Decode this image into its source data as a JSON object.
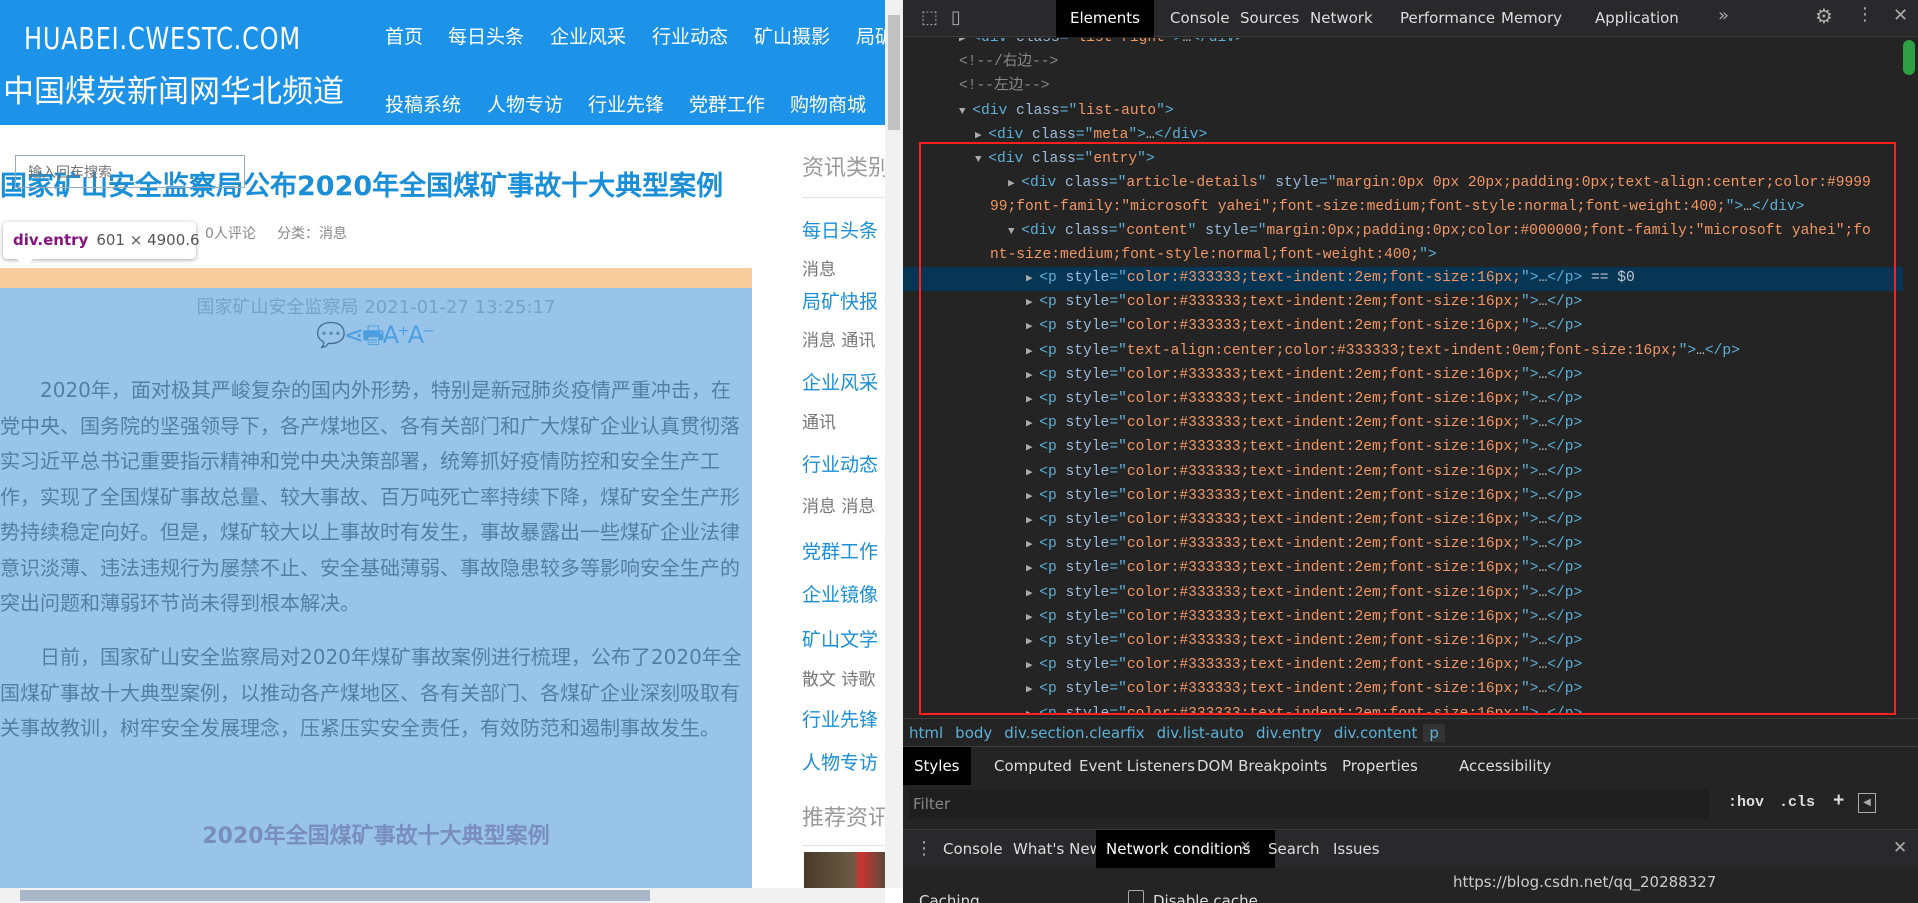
{
  "page": {
    "logo_en": "HUABEI.CWESTC.COM",
    "logo_cn": "中国煤炭新闻网华北频道",
    "nav_row1": [
      "首页",
      "每日头条",
      "企业风采",
      "行业动态",
      "矿山摄影",
      "局矿快报"
    ],
    "nav_row2": [
      "投稿系统",
      "人物专访",
      "行业先锋",
      "党群工作",
      "购物商城"
    ],
    "search_placeholder": "输入回车搜索",
    "title": "国家矿山安全监察局公布2020年全国煤矿事故十大典型案例",
    "meta_comments": "0人评论",
    "meta_category": "分类：消息",
    "tooltip": {
      "name": "div.entry",
      "size": "601 × 4900.6"
    },
    "article_source": "国家矿山安全监察局 2021-01-27 13:25:17",
    "share_icons": "💬⋖🖶A⁺A⁻",
    "paragraphs": [
      "2020年，面对极其严峻复杂的国内外形势，特别是新冠肺炎疫情严重冲击，在党中央、国务院的坚强领导下，各产煤地区、各有关部门和广大煤矿企业认真贯彻落实习近平总书记重要指示精神和党中央决策部署，统筹抓好疫情防控和安全生产工作，实现了全国煤矿事故总量、较大事故、百万吨死亡率持续下降，煤矿安全生产形势持续稳定向好。但是，煤矿较大以上事故时有发生，事故暴露出一些煤矿企业法律意识淡薄、违法违规行为屡禁不止、安全基础薄弱、事故隐患较多等影响安全生产的突出问题和薄弱环节尚未得到根本解决。",
      "日前，国家矿山安全监察局对2020年煤矿事故案例进行梳理，公布了2020年全国煤矿事故十大典型案例，以推动各产煤地区、各有关部门、各煤矿企业深刻吸取有关事故教训，树牢安全发展理念，压紧压实安全责任，有效防范和遏制事故发生。"
    ],
    "subheading": "2020年全国煤矿事故十大典型案例",
    "sidebar": {
      "heading": "资讯类别",
      "items": [
        {
          "label": "每日头条",
          "tags": "消息"
        },
        {
          "label": "局矿快报",
          "tags": "消息  通讯"
        },
        {
          "label": "企业风采",
          "tags": "通讯"
        },
        {
          "label": "行业动态",
          "tags": "消息  消息"
        },
        {
          "label": "党群工作",
          "tags": ""
        },
        {
          "label": "企业镜像",
          "tags": ""
        },
        {
          "label": "矿山文学",
          "tags": "散文  诗歌"
        },
        {
          "label": "行业先锋",
          "tags": ""
        },
        {
          "label": "人物专访",
          "tags": ""
        }
      ],
      "heading2": "推荐资讯"
    }
  },
  "devtools": {
    "tabs": [
      "Elements",
      "Console",
      "Sources",
      "Network",
      "Performance",
      "Memory",
      "Application"
    ],
    "active_tab": "Elements",
    "more": "»",
    "dom_lines": [
      {
        "i": 1,
        "ar": "▶",
        "s": [
          [
            "t",
            "<div "
          ],
          [
            "a",
            "class"
          ],
          [
            "t",
            "=\""
          ],
          [
            "v",
            "list-right"
          ],
          [
            "t",
            "\">"
          ],
          [
            "x",
            "…"
          ],
          [
            "t",
            "</div>"
          ]
        ]
      },
      {
        "i": 1,
        "ar": "",
        "s": [
          [
            "c",
            "<!--/右边-->"
          ]
        ]
      },
      {
        "i": 1,
        "ar": "",
        "s": [
          [
            "c",
            "<!--左边-->"
          ]
        ]
      },
      {
        "i": 1,
        "ar": "▼",
        "s": [
          [
            "t",
            "<div "
          ],
          [
            "a",
            "class"
          ],
          [
            "t",
            "=\""
          ],
          [
            "v",
            "list-auto"
          ],
          [
            "t",
            "\">"
          ]
        ]
      },
      {
        "i": 2,
        "ar": "▶",
        "s": [
          [
            "t",
            "<div "
          ],
          [
            "a",
            "class"
          ],
          [
            "t",
            "=\""
          ],
          [
            "v",
            "meta"
          ],
          [
            "t",
            "\">"
          ],
          [
            "x",
            "…"
          ],
          [
            "t",
            "</div>"
          ]
        ]
      },
      {
        "i": 2,
        "ar": "▼",
        "s": [
          [
            "t",
            "<div "
          ],
          [
            "a",
            "class"
          ],
          [
            "t",
            "=\""
          ],
          [
            "v",
            "entry"
          ],
          [
            "t",
            "\">"
          ]
        ]
      },
      {
        "i": 3,
        "ar": "▶",
        "s": [
          [
            "t",
            "<div "
          ],
          [
            "a",
            "class"
          ],
          [
            "t",
            "=\""
          ],
          [
            "v",
            "article-details"
          ],
          [
            "t",
            "\" "
          ],
          [
            "a",
            "style"
          ],
          [
            "t",
            "=\""
          ],
          [
            "v",
            "margin:0px 0px 20px;padding:0px;text-align:center;color:#999999;font-family:\"microsoft yahei\";font-size:medium;font-style:normal;font-weight:400;"
          ],
          [
            "t",
            "\">"
          ],
          [
            "x",
            "…"
          ],
          [
            "t",
            "</div>"
          ]
        ]
      },
      {
        "i": 3,
        "ar": "▼",
        "s": [
          [
            "t",
            "<div "
          ],
          [
            "a",
            "class"
          ],
          [
            "t",
            "=\""
          ],
          [
            "v",
            "content"
          ],
          [
            "t",
            "\" "
          ],
          [
            "a",
            "style"
          ],
          [
            "t",
            "=\""
          ],
          [
            "v",
            "margin:0px;padding:0px;color:#000000;font-family:\"microsoft yahei\";font-size:medium;font-style:normal;font-weight:400;"
          ],
          [
            "t",
            "\">"
          ]
        ]
      },
      {
        "i": 4,
        "ar": "▶",
        "sel": true,
        "s": [
          [
            "t",
            "<p "
          ],
          [
            "a",
            "style"
          ],
          [
            "t",
            "=\""
          ],
          [
            "v",
            "color:#333333;text-indent:2em;font-size:16px;"
          ],
          [
            "t",
            "\">"
          ],
          [
            "x",
            "…"
          ],
          [
            "t",
            "</p>"
          ],
          [
            "x",
            " == $0"
          ]
        ]
      },
      {
        "i": 4,
        "ar": "▶",
        "s": [
          [
            "t",
            "<p "
          ],
          [
            "a",
            "style"
          ],
          [
            "t",
            "=\""
          ],
          [
            "v",
            "color:#333333;text-indent:2em;font-size:16px;"
          ],
          [
            "t",
            "\">"
          ],
          [
            "x",
            "…"
          ],
          [
            "t",
            "</p>"
          ]
        ]
      },
      {
        "i": 4,
        "ar": "▶",
        "s": [
          [
            "t",
            "<p "
          ],
          [
            "a",
            "style"
          ],
          [
            "t",
            "=\""
          ],
          [
            "v",
            "color:#333333;text-indent:2em;font-size:16px;"
          ],
          [
            "t",
            "\">"
          ],
          [
            "x",
            "…"
          ],
          [
            "t",
            "</p>"
          ]
        ]
      },
      {
        "i": 4,
        "ar": "▶",
        "s": [
          [
            "t",
            "<p "
          ],
          [
            "a",
            "style"
          ],
          [
            "t",
            "=\""
          ],
          [
            "v",
            "text-align:center;color:#333333;text-indent:0em;font-size:16px;"
          ],
          [
            "t",
            "\">"
          ],
          [
            "x",
            "…"
          ],
          [
            "t",
            "</p>"
          ]
        ]
      },
      {
        "i": 4,
        "ar": "▶",
        "s": [
          [
            "t",
            "<p "
          ],
          [
            "a",
            "style"
          ],
          [
            "t",
            "=\""
          ],
          [
            "v",
            "color:#333333;text-indent:2em;font-size:16px;"
          ],
          [
            "t",
            "\">"
          ],
          [
            "x",
            "…"
          ],
          [
            "t",
            "</p>"
          ]
        ]
      },
      {
        "i": 4,
        "ar": "▶",
        "s": [
          [
            "t",
            "<p "
          ],
          [
            "a",
            "style"
          ],
          [
            "t",
            "=\""
          ],
          [
            "v",
            "color:#333333;text-indent:2em;font-size:16px;"
          ],
          [
            "t",
            "\">"
          ],
          [
            "x",
            "…"
          ],
          [
            "t",
            "</p>"
          ]
        ]
      },
      {
        "i": 4,
        "ar": "▶",
        "s": [
          [
            "t",
            "<p "
          ],
          [
            "a",
            "style"
          ],
          [
            "t",
            "=\""
          ],
          [
            "v",
            "color:#333333;text-indent:2em;font-size:16px;"
          ],
          [
            "t",
            "\">"
          ],
          [
            "x",
            "…"
          ],
          [
            "t",
            "</p>"
          ]
        ]
      },
      {
        "i": 4,
        "ar": "▶",
        "s": [
          [
            "t",
            "<p "
          ],
          [
            "a",
            "style"
          ],
          [
            "t",
            "=\""
          ],
          [
            "v",
            "color:#333333;text-indent:2em;font-size:16px;"
          ],
          [
            "t",
            "\">"
          ],
          [
            "x",
            "…"
          ],
          [
            "t",
            "</p>"
          ]
        ]
      },
      {
        "i": 4,
        "ar": "▶",
        "s": [
          [
            "t",
            "<p "
          ],
          [
            "a",
            "style"
          ],
          [
            "t",
            "=\""
          ],
          [
            "v",
            "color:#333333;text-indent:2em;font-size:16px;"
          ],
          [
            "t",
            "\">"
          ],
          [
            "x",
            "…"
          ],
          [
            "t",
            "</p>"
          ]
        ]
      },
      {
        "i": 4,
        "ar": "▶",
        "s": [
          [
            "t",
            "<p "
          ],
          [
            "a",
            "style"
          ],
          [
            "t",
            "=\""
          ],
          [
            "v",
            "color:#333333;text-indent:2em;font-size:16px;"
          ],
          [
            "t",
            "\">"
          ],
          [
            "x",
            "…"
          ],
          [
            "t",
            "</p>"
          ]
        ]
      },
      {
        "i": 4,
        "ar": "▶",
        "s": [
          [
            "t",
            "<p "
          ],
          [
            "a",
            "style"
          ],
          [
            "t",
            "=\""
          ],
          [
            "v",
            "color:#333333;text-indent:2em;font-size:16px;"
          ],
          [
            "t",
            "\">"
          ],
          [
            "x",
            "…"
          ],
          [
            "t",
            "</p>"
          ]
        ]
      },
      {
        "i": 4,
        "ar": "▶",
        "s": [
          [
            "t",
            "<p "
          ],
          [
            "a",
            "style"
          ],
          [
            "t",
            "=\""
          ],
          [
            "v",
            "color:#333333;text-indent:2em;font-size:16px;"
          ],
          [
            "t",
            "\">"
          ],
          [
            "x",
            "…"
          ],
          [
            "t",
            "</p>"
          ]
        ]
      },
      {
        "i": 4,
        "ar": "▶",
        "s": [
          [
            "t",
            "<p "
          ],
          [
            "a",
            "style"
          ],
          [
            "t",
            "=\""
          ],
          [
            "v",
            "color:#333333;text-indent:2em;font-size:16px;"
          ],
          [
            "t",
            "\">"
          ],
          [
            "x",
            "…"
          ],
          [
            "t",
            "</p>"
          ]
        ]
      },
      {
        "i": 4,
        "ar": "▶",
        "s": [
          [
            "t",
            "<p "
          ],
          [
            "a",
            "style"
          ],
          [
            "t",
            "=\""
          ],
          [
            "v",
            "color:#333333;text-indent:2em;font-size:16px;"
          ],
          [
            "t",
            "\">"
          ],
          [
            "x",
            "…"
          ],
          [
            "t",
            "</p>"
          ]
        ]
      },
      {
        "i": 4,
        "ar": "▶",
        "s": [
          [
            "t",
            "<p "
          ],
          [
            "a",
            "style"
          ],
          [
            "t",
            "=\""
          ],
          [
            "v",
            "color:#333333;text-indent:2em;font-size:16px;"
          ],
          [
            "t",
            "\">"
          ],
          [
            "x",
            "…"
          ],
          [
            "t",
            "</p>"
          ]
        ]
      },
      {
        "i": 4,
        "ar": "▶",
        "s": [
          [
            "t",
            "<p "
          ],
          [
            "a",
            "style"
          ],
          [
            "t",
            "=\""
          ],
          [
            "v",
            "color:#333333;text-indent:2em;font-size:16px;"
          ],
          [
            "t",
            "\">"
          ],
          [
            "x",
            "…"
          ],
          [
            "t",
            "</p>"
          ]
        ]
      },
      {
        "i": 4,
        "ar": "▶",
        "s": [
          [
            "t",
            "<p "
          ],
          [
            "a",
            "style"
          ],
          [
            "t",
            "=\""
          ],
          [
            "v",
            "color:#333333;text-indent:2em;font-size:16px;"
          ],
          [
            "t",
            "\">"
          ],
          [
            "x",
            "…"
          ],
          [
            "t",
            "</p>"
          ]
        ]
      },
      {
        "i": 4,
        "ar": "▶",
        "s": [
          [
            "t",
            "<p "
          ],
          [
            "a",
            "style"
          ],
          [
            "t",
            "=\""
          ],
          [
            "v",
            "color:#333333;text-indent:2em;font-size:16px;"
          ],
          [
            "t",
            "\">"
          ],
          [
            "x",
            "…"
          ],
          [
            "t",
            "</p>"
          ]
        ]
      },
      {
        "i": 4,
        "ar": "▶",
        "s": [
          [
            "t",
            "<p "
          ],
          [
            "a",
            "style"
          ],
          [
            "t",
            "=\""
          ],
          [
            "v",
            "color:#333333;text-indent:2em;font-size:16px;"
          ],
          [
            "t",
            "\">"
          ],
          [
            "x",
            "…"
          ],
          [
            "t",
            "</p>"
          ]
        ]
      },
      {
        "i": 4,
        "ar": "▶",
        "s": [
          [
            "t",
            "<p "
          ],
          [
            "a",
            "style"
          ],
          [
            "t",
            "=\""
          ],
          [
            "v",
            "color:#333333;text-indent:2em;font-size:16px;"
          ],
          [
            "t",
            "\">"
          ],
          [
            "x",
            "…"
          ],
          [
            "t",
            "</p>"
          ]
        ]
      }
    ],
    "breadcrumbs": [
      "html",
      "body",
      "div.section.clearfix",
      "div.list-auto",
      "div.entry",
      "div.content",
      "p"
    ],
    "style_tabs": [
      "Styles",
      "Computed",
      "Event Listeners",
      "DOM Breakpoints",
      "Properties",
      "Accessibility"
    ],
    "filter_placeholder": "Filter",
    "hov": ":hov",
    "cls": ".cls",
    "drawer_tabs": [
      "Console",
      "What's New",
      "Network conditions",
      "Search",
      "Issues"
    ],
    "caching_label": "Caching",
    "disable_cache_label": "Disable cache",
    "disable_cache_checked": false
  },
  "watermark": "https://blog.csdn.net/qq_20288327",
  "colors": {
    "header_blue": "#1c93e8",
    "title_blue": "#1a8fd8",
    "highlight_margin": "#f9cc9d",
    "highlight_content": "#9ac5e6",
    "devtools_bg": "#242424",
    "selection_box": "#ff1f1f"
  }
}
